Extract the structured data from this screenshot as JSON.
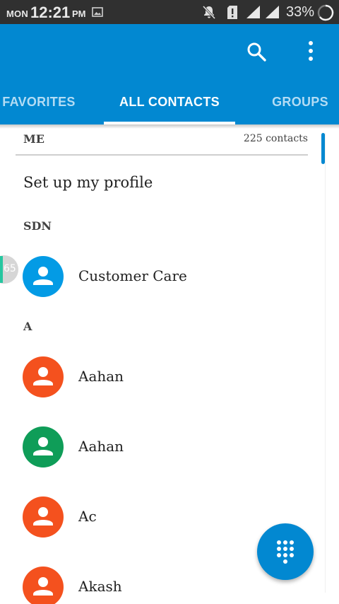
{
  "status_bar": {
    "day": "MON",
    "time": "12:21",
    "ampm": "PM",
    "battery": "33%",
    "icons": [
      "image-icon",
      "notifications-off-icon",
      "sim-alert-icon",
      "signal-icon",
      "signal-icon",
      "battery-charging-icon"
    ]
  },
  "app_bar": {
    "color": "#0288d1",
    "actions": [
      "search-icon",
      "more-vert-icon"
    ],
    "tabs": [
      {
        "label": "FAVORITES",
        "active": false
      },
      {
        "label": "ALL CONTACTS",
        "active": true
      },
      {
        "label": "GROUPS",
        "active": false
      }
    ]
  },
  "list": {
    "me_header": "ME",
    "contacts_count": "225 contacts",
    "profile_item": "Set up my profile",
    "sections": [
      {
        "header": "SDN",
        "contacts": [
          {
            "name": "Customer Care",
            "avatar_color": "#039be5"
          }
        ]
      },
      {
        "header": "A",
        "contacts": [
          {
            "name": "Aahan",
            "avatar_color": "#f4511e"
          },
          {
            "name": "Aahan",
            "avatar_color": "#0f9d58"
          },
          {
            "name": "Ac",
            "avatar_color": "#f4511e"
          },
          {
            "name": "Akash",
            "avatar_color": "#f4511e"
          }
        ]
      }
    ],
    "side_badge": "65"
  },
  "fab": {
    "icon": "dialpad-icon",
    "color": "#0288d1"
  }
}
